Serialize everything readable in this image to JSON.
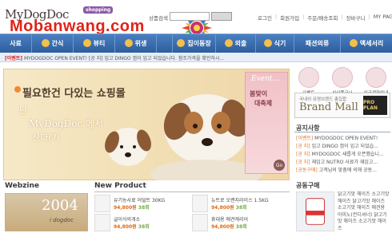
{
  "header": {
    "logo": "MyDogDoc",
    "logo_tag": "shopping",
    "watermark": "Mobanwang.com",
    "search_label": "상품검색",
    "top_links": [
      "로그인",
      "회원가입",
      "주문/배송조회",
      "장바구니",
      "MY PAGE"
    ]
  },
  "nav": {
    "items": [
      "사료",
      "간식",
      "뷰티",
      "위생",
      "",
      "집이동장",
      "외출",
      "식기",
      "패션의류",
      "액세서리"
    ]
  },
  "ticker": {
    "prefix": "[이벤트]",
    "text": "MYDOGDOC OPEN EVENT! [공 지] 입고 DINGO 껌이 입고 되었습니다. 참조가격을 확인하시..."
  },
  "banner": {
    "title": "필요한건 다있는 쇼핑몰",
    "line1": "난",
    "line2": "MyDogDoc 에서",
    "line3": "산다(?)",
    "event_title": "Event...",
    "event_line1": "봄맞이",
    "event_line2": "대축제",
    "go": "Go"
  },
  "quick_links": [
    "이벤트",
    "신상품코너",
    "입금계좌안내"
  ],
  "brand": {
    "small": "국내외 유명브랜드 총집합",
    "big": "Brand Mall",
    "thumb": "PRO PLAN"
  },
  "notice": {
    "title": "공지사항",
    "items": [
      {
        "tag": "[이벤트]",
        "text": "MYDOGDOC OPEN EVENT!"
      },
      {
        "tag": "[공 지]",
        "text": "입고 DINGO 껌이 입고 되었습..."
      },
      {
        "tag": "[공 지]",
        "text": "MYDOGDOC 새롭게 오픈했습니..."
      },
      {
        "tag": "[공 지]",
        "text": "재입고 NUTRO 사료가 재입고..."
      },
      {
        "tag": "[공동구매]",
        "text": "고객님의 맞춤에 의해 공동..."
      }
    ]
  },
  "group_buy": {
    "title": "공동구매",
    "text": "닭고기맛 해이즈 소고기맛 해이즈 닭고기맛 해이즈 소고기맛 해이즈 애견용 아미노(컨디셔너) 닭고기맛 해이즈 소고기맛 해이즈"
  },
  "webzine": {
    "title": "Webzine",
    "year": "2004",
    "caption": "i dogdoc"
  },
  "new_product": {
    "title": "New Product",
    "items": [
      {
        "name": "유기농사료 어덜트 30KG",
        "price": "94,800원",
        "sale": "38회"
      },
      {
        "name": "뉴트로 오랜지라이스 1.5KG",
        "price": "94,800원",
        "sale": "38회"
      },
      {
        "name": "글이식의개소",
        "price": "94,800원",
        "sale": "38회"
      },
      {
        "name": "휴대용 애견캐리어",
        "price": "94,800원",
        "sale": "38회"
      }
    ]
  },
  "colors": {
    "nav": "#2d5e9e",
    "price": "#e06a12",
    "watermark": "#e0231a",
    "accent": "#8a5aa8"
  }
}
